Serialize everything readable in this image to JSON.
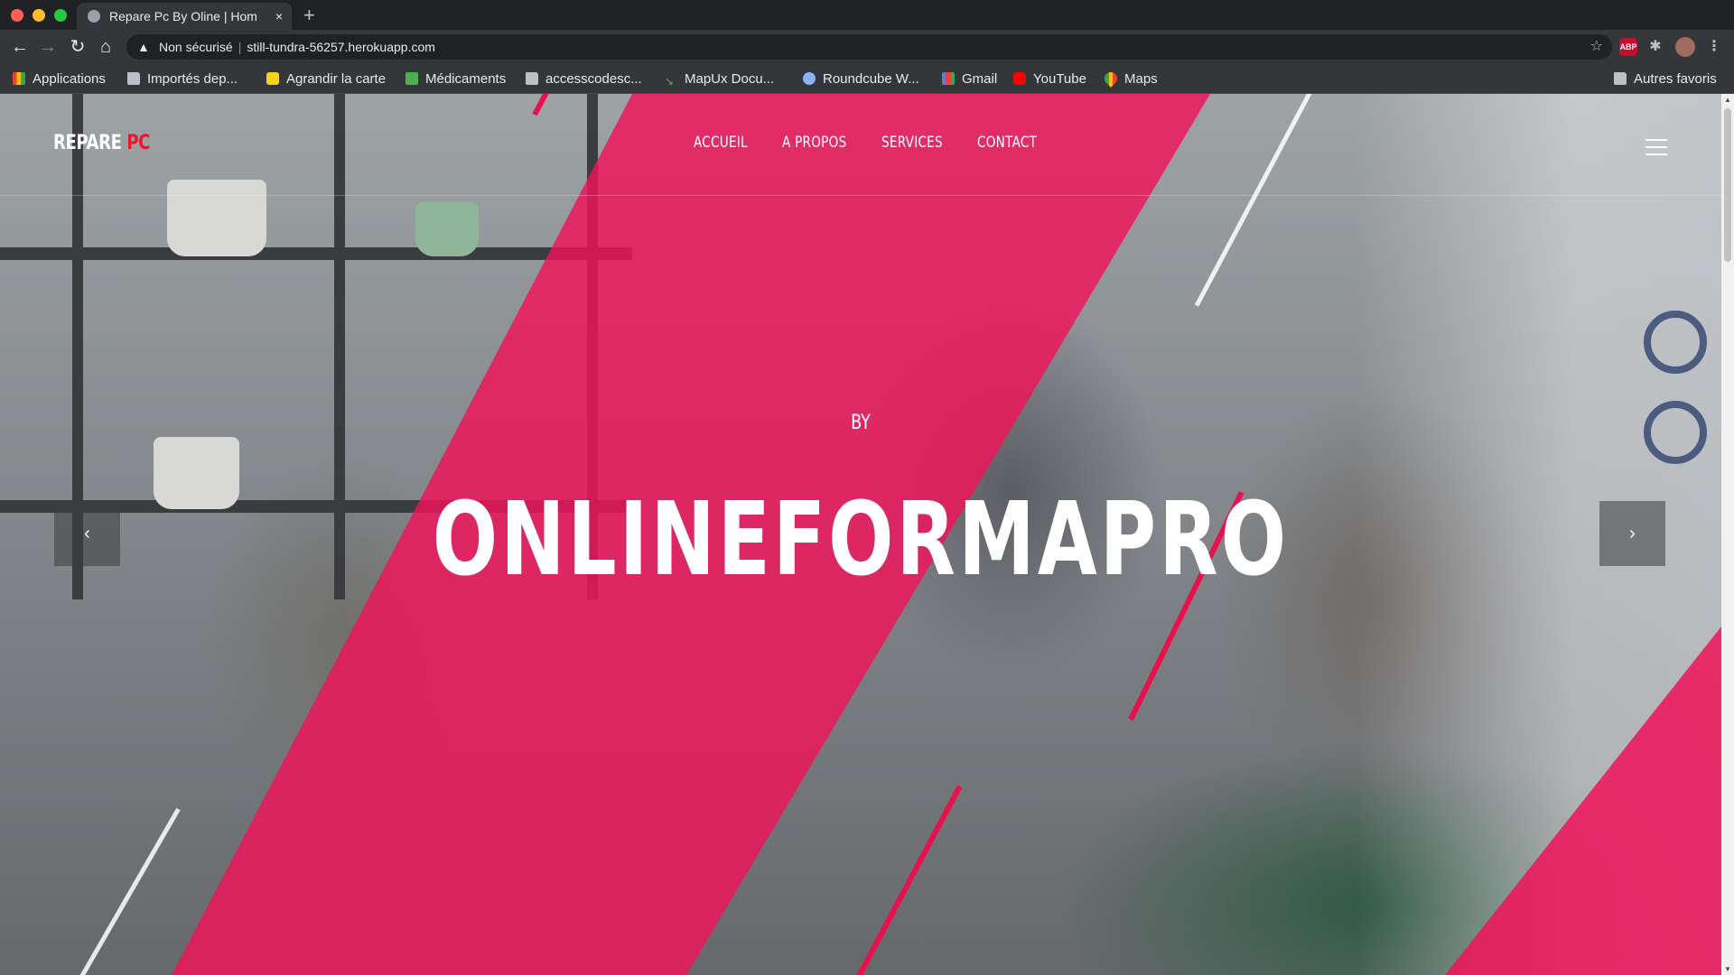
{
  "browser": {
    "tab_title": "Repare Pc By Oline | Hom",
    "tab_close": "×",
    "new_tab": "+",
    "security_label": "Non sécurisé",
    "url": "still-tundra-56257.herokuapp.com",
    "abp_label": "ABP"
  },
  "bookmarks": [
    {
      "label": "Applications",
      "icon": "apps-icon"
    },
    {
      "label": "Importés dep...",
      "icon": "folder-icon"
    },
    {
      "label": "Agrandir la carte",
      "icon": "smile-icon"
    },
    {
      "label": "Médicaments",
      "icon": "pharmacy-icon"
    },
    {
      "label": "accesscodesc...",
      "icon": "folder-icon"
    },
    {
      "label": "MapUx Docu...",
      "icon": "mapux-icon"
    },
    {
      "label": "Roundcube W...",
      "icon": "roundcube-icon"
    },
    {
      "label": "Gmail",
      "icon": "gmail-icon"
    },
    {
      "label": "YouTube",
      "icon": "youtube-icon"
    },
    {
      "label": "Maps",
      "icon": "maps-icon"
    },
    {
      "label": "Autres favoris",
      "icon": "folder-icon"
    }
  ],
  "site": {
    "logo_main": "REPARE ",
    "logo_accent": "PC",
    "nav": [
      "ACCUEIL",
      "A PROPOS",
      "SERVICES",
      "CONTACT"
    ],
    "hero_subtitle": "BY",
    "hero_title": "ONLINEFORMAPRO",
    "accent_color": "#e8114d"
  }
}
